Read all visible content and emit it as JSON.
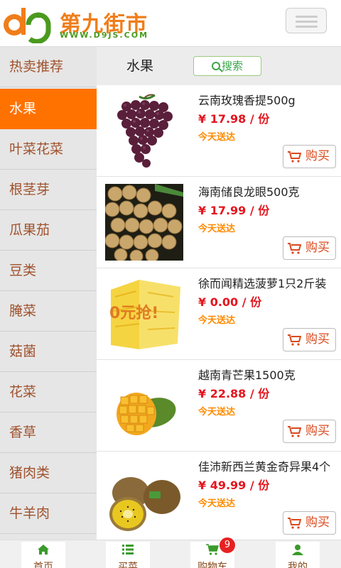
{
  "header": {
    "logo_cn": "第九街市",
    "logo_en": "WWW.D9JS.COM"
  },
  "sidebar": {
    "items": [
      {
        "label": "热卖推荐",
        "active": false
      },
      {
        "label": "水果",
        "active": true
      },
      {
        "label": "叶菜花菜",
        "active": false
      },
      {
        "label": "根茎芽",
        "active": false
      },
      {
        "label": "瓜果茄",
        "active": false
      },
      {
        "label": "豆类",
        "active": false
      },
      {
        "label": "腌菜",
        "active": false
      },
      {
        "label": "菇菌",
        "active": false
      },
      {
        "label": "花菜",
        "active": false
      },
      {
        "label": "香草",
        "active": false
      },
      {
        "label": "猪肉类",
        "active": false
      },
      {
        "label": "牛羊肉",
        "active": false
      }
    ]
  },
  "main": {
    "title": "水果",
    "search_label": "搜索",
    "products": [
      {
        "name": "云南玫瑰香提500g",
        "price": "¥ 17.98 / 份",
        "delivery": "今天送达",
        "buy_label": "购买",
        "image": "grapes"
      },
      {
        "name": "海南储良龙眼500克",
        "price": "¥ 17.99 / 份",
        "delivery": "今天送达",
        "buy_label": "购买",
        "image": "longan"
      },
      {
        "name": "徐而闻精选菠萝1只2斤装",
        "price": "¥ 0.00 / 份",
        "delivery": "今天送达",
        "buy_label": "购买",
        "image": "pineapple",
        "image_text": "0元抢!"
      },
      {
        "name": "越南青芒果1500克",
        "price": "¥ 22.88 / 份",
        "delivery": "今天送达",
        "buy_label": "购买",
        "image": "mango"
      },
      {
        "name": "佳沛新西兰黄金奇异果4个",
        "price": "¥ 49.99 / 份",
        "delivery": "今天送达",
        "buy_label": "购买",
        "image": "kiwi"
      }
    ]
  },
  "footer": {
    "tabs": [
      {
        "label": "首页",
        "icon": "home-icon"
      },
      {
        "label": "买菜",
        "icon": "list-icon"
      },
      {
        "label": "购物车",
        "icon": "cart-icon"
      },
      {
        "label": "我的",
        "icon": "user-icon"
      }
    ],
    "cart_count": "9"
  },
  "colors": {
    "accent_orange": "#ff7200",
    "price_red": "#e4151e",
    "delivery_orange": "#ff8a00",
    "brand_green": "#4a9a1e",
    "sidebar_text": "#a0522d"
  }
}
